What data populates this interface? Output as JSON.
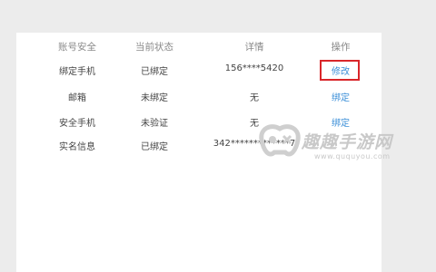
{
  "table": {
    "headers": [
      "账号安全",
      "当前状态",
      "详情",
      "操作"
    ],
    "rows": [
      {
        "item": "绑定手机",
        "status": "已绑定",
        "detail": "156****5420",
        "action": "修改"
      },
      {
        "item": "邮箱",
        "status": "未绑定",
        "detail": "无",
        "action": "绑定"
      },
      {
        "item": "安全手机",
        "status": "未验证",
        "detail": "无",
        "action": "绑定"
      },
      {
        "item": "实名信息",
        "status": "已绑定",
        "detail": "342*************7",
        "action": ""
      }
    ]
  },
  "highlight_color": "#d9262a",
  "link_color": "#3b8fd8",
  "watermark": {
    "text": "趣趣手游网",
    "url": "www.ququyou.com",
    "icon": "gamepad-logo-icon"
  }
}
